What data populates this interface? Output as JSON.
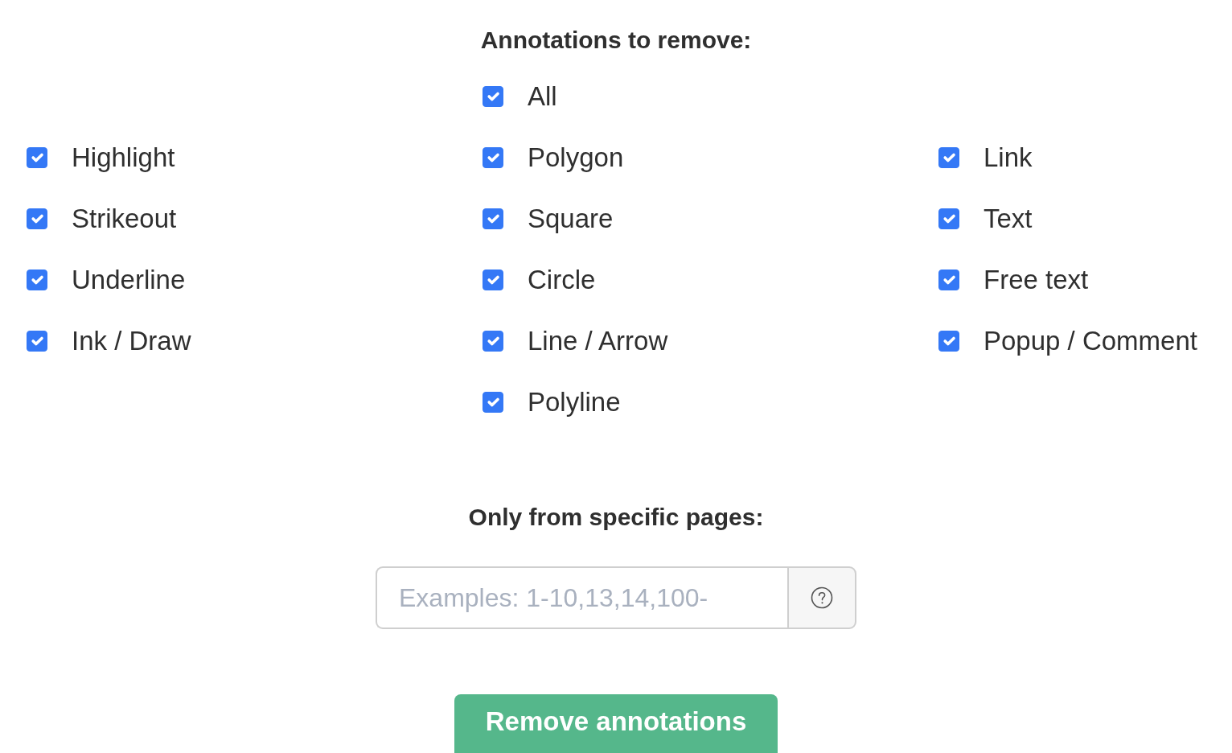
{
  "annotations": {
    "title": "Annotations to remove:",
    "all_option": {
      "label": "All",
      "checked": true
    },
    "columns": [
      {
        "items": [
          {
            "label": "Highlight",
            "checked": true
          },
          {
            "label": "Strikeout",
            "checked": true
          },
          {
            "label": "Underline",
            "checked": true
          },
          {
            "label": "Ink / Draw",
            "checked": true
          }
        ]
      },
      {
        "items": [
          {
            "label": "Polygon",
            "checked": true
          },
          {
            "label": "Square",
            "checked": true
          },
          {
            "label": "Circle",
            "checked": true
          },
          {
            "label": "Line / Arrow",
            "checked": true
          },
          {
            "label": "Polyline",
            "checked": true
          }
        ]
      },
      {
        "items": [
          {
            "label": "Link",
            "checked": true
          },
          {
            "label": "Text",
            "checked": true
          },
          {
            "label": "Free text",
            "checked": true
          },
          {
            "label": "Popup / Comment",
            "checked": true
          }
        ]
      }
    ]
  },
  "pages": {
    "title": "Only from specific pages:",
    "input": {
      "placeholder": "Examples: 1-10,13,14,100-"
    }
  },
  "submit_button": {
    "label": "Remove annotations"
  }
}
